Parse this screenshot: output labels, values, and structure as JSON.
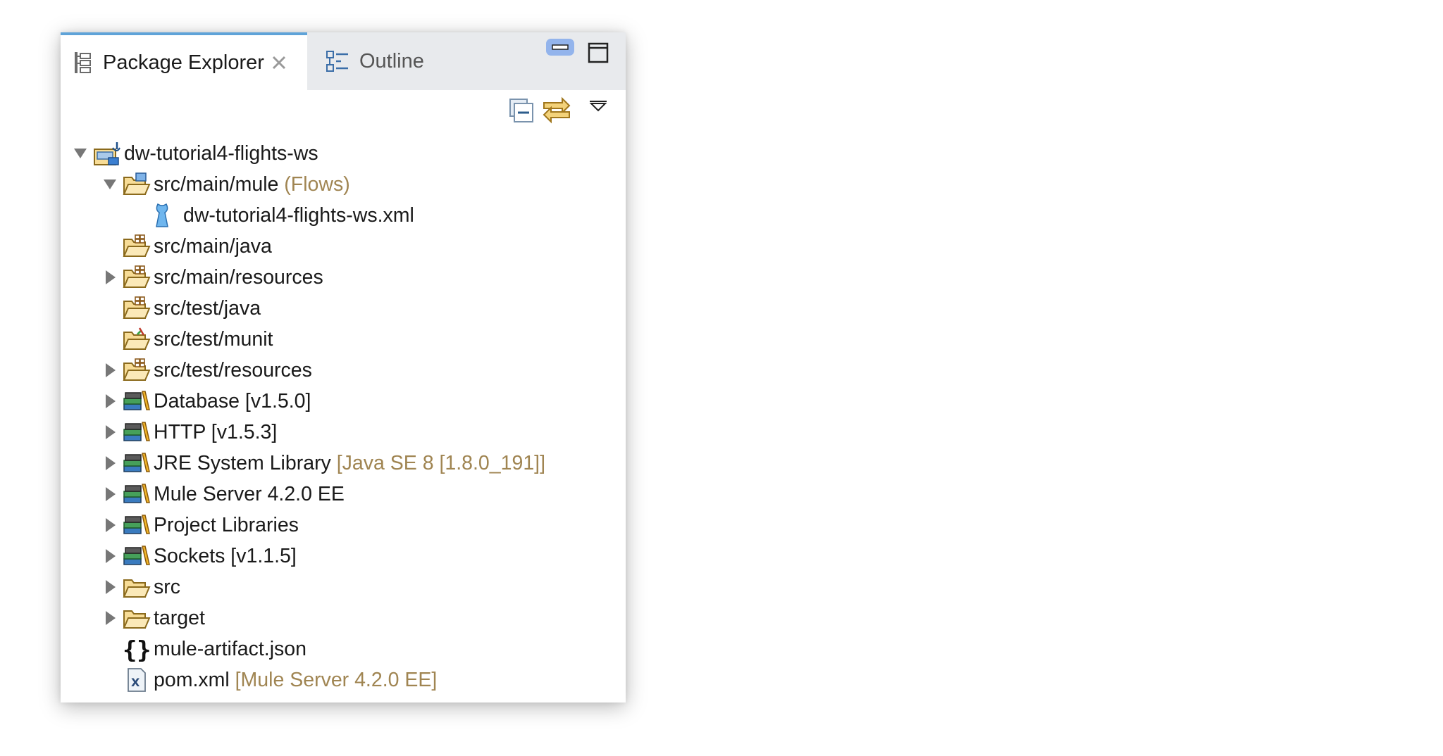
{
  "tabs": [
    {
      "label": "Package Explorer",
      "icon": "package-explorer-icon",
      "active": true
    },
    {
      "label": "Outline",
      "icon": "outline-icon",
      "active": false
    }
  ],
  "toolbar": {
    "collapse_all_icon": "collapse-all-icon",
    "link_with_editor_icon": "link-with-editor-icon",
    "view_menu_icon": "view-menu-icon"
  },
  "window_controls": {
    "minimize_icon": "minimize-icon",
    "maximize_icon": "maximize-icon"
  },
  "colors": {
    "decoration": "#a08552",
    "tab_accent": "#5fa3d8",
    "tab_bar": "#e8eaed"
  },
  "tree": [
    {
      "label": "dw-tutorial4-flights-ws",
      "decoration": "",
      "icon": "mule-project-icon",
      "twisty": "expanded",
      "depth": 0
    },
    {
      "label": "src/main/mule",
      "decoration": " (Flows)",
      "icon": "mule-source-folder-icon",
      "twisty": "expanded",
      "depth": 1
    },
    {
      "label": "dw-tutorial4-flights-ws.xml",
      "decoration": "",
      "icon": "mule-flow-file-icon",
      "twisty": "none",
      "depth": 2
    },
    {
      "label": "src/main/java",
      "decoration": "",
      "icon": "source-folder-icon",
      "twisty": "none",
      "depth": 1
    },
    {
      "label": "src/main/resources",
      "decoration": "",
      "icon": "source-folder-icon",
      "twisty": "collapsed",
      "depth": 1
    },
    {
      "label": "src/test/java",
      "decoration": "",
      "icon": "source-folder-icon",
      "twisty": "none",
      "depth": 1
    },
    {
      "label": "src/test/munit",
      "decoration": "",
      "icon": "munit-folder-icon",
      "twisty": "none",
      "depth": 1
    },
    {
      "label": "src/test/resources",
      "decoration": "",
      "icon": "source-folder-icon",
      "twisty": "collapsed",
      "depth": 1
    },
    {
      "label": "Database [v1.5.0]",
      "decoration": "",
      "icon": "library-icon",
      "twisty": "collapsed",
      "depth": 1
    },
    {
      "label": "HTTP [v1.5.3]",
      "decoration": "",
      "icon": "library-icon",
      "twisty": "collapsed",
      "depth": 1
    },
    {
      "label": "JRE System Library",
      "decoration": " [Java SE 8 [1.8.0_191]]",
      "icon": "library-icon",
      "twisty": "collapsed",
      "depth": 1
    },
    {
      "label": "Mule Server 4.2.0 EE",
      "decoration": "",
      "icon": "library-icon",
      "twisty": "collapsed",
      "depth": 1
    },
    {
      "label": "Project Libraries",
      "decoration": "",
      "icon": "library-icon",
      "twisty": "collapsed",
      "depth": 1
    },
    {
      "label": "Sockets [v1.1.5]",
      "decoration": "",
      "icon": "library-icon",
      "twisty": "collapsed",
      "depth": 1
    },
    {
      "label": "src",
      "decoration": "",
      "icon": "folder-icon",
      "twisty": "collapsed",
      "depth": 1
    },
    {
      "label": "target",
      "decoration": "",
      "icon": "folder-icon",
      "twisty": "collapsed",
      "depth": 1
    },
    {
      "label": "mule-artifact.json",
      "decoration": "",
      "icon": "json-file-icon",
      "twisty": "none",
      "depth": 1
    },
    {
      "label": "pom.xml",
      "decoration": " [Mule Server 4.2.0 EE]",
      "icon": "xml-file-icon",
      "twisty": "none",
      "depth": 1
    }
  ]
}
